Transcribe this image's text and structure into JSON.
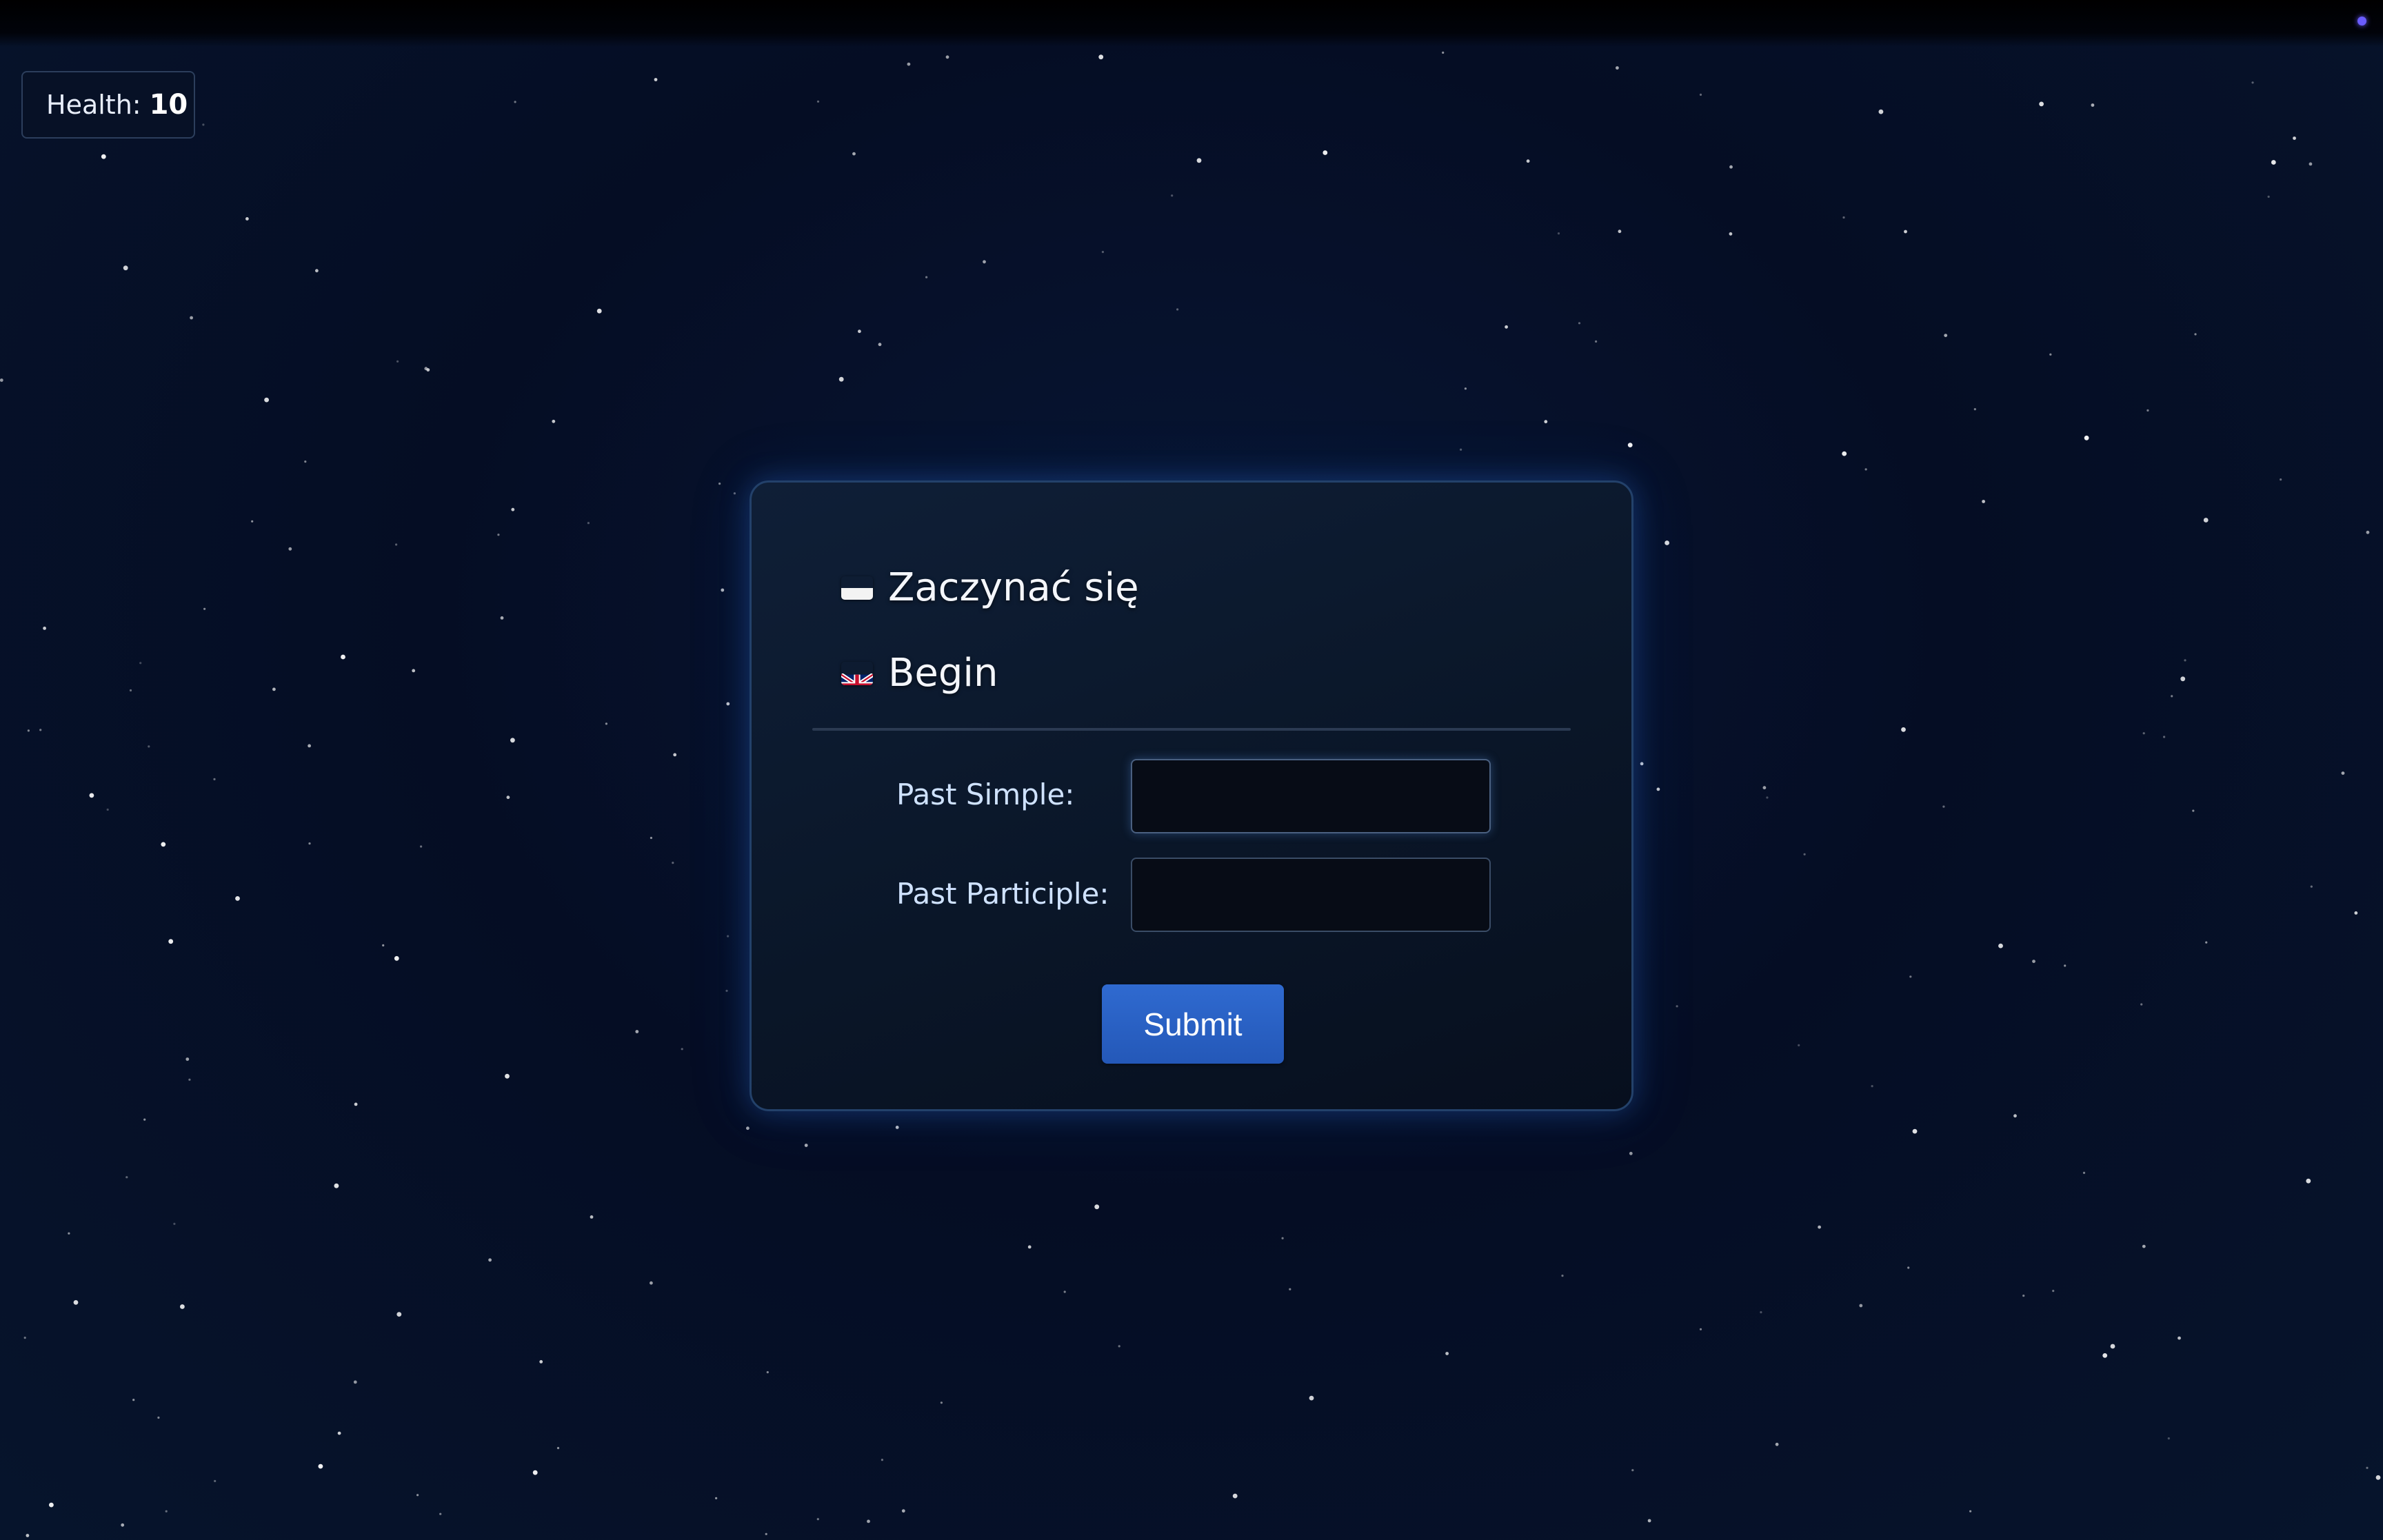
{
  "status": {
    "health_label": "Health:",
    "health_value": "10"
  },
  "card": {
    "source_word": {
      "flag": "poland-flag-icon",
      "text": "Zaczynać się"
    },
    "target_word": {
      "flag": "uk-flag-icon",
      "text": "Begin"
    },
    "fields": {
      "past_simple_label": "Past Simple:",
      "past_simple_value": "",
      "past_participle_label": "Past Participle:",
      "past_participle_value": ""
    },
    "submit_label": "Submit"
  },
  "colors": {
    "background": "#050d24",
    "accent": "#2f6ad0",
    "card_border": "#23416a",
    "indicator_dot": "#6a5cff"
  }
}
